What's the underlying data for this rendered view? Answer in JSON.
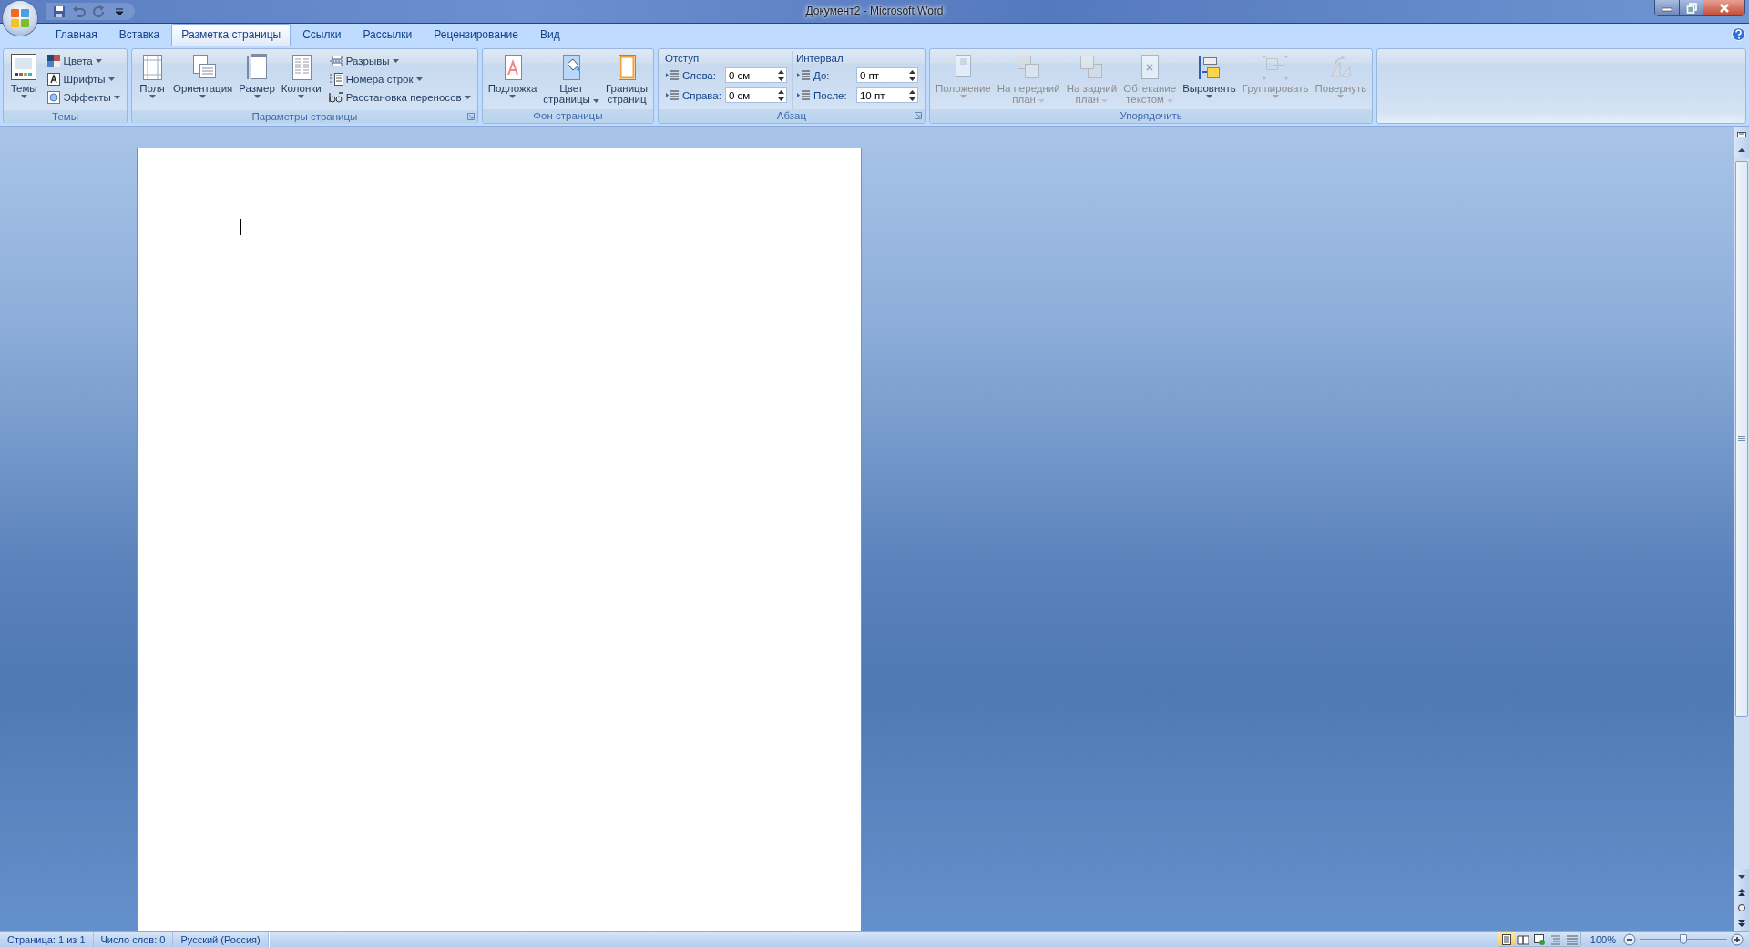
{
  "title_bar": {
    "title": "Документ2 - Microsoft Word"
  },
  "quick_access": [
    {
      "disabled": false
    },
    {
      "disabled": true
    },
    {
      "disabled": true
    },
    {
      "disabled": false
    }
  ],
  "tabs": [
    {
      "label": "Главная",
      "selected": false
    },
    {
      "label": "Вставка",
      "selected": false
    },
    {
      "label": "Разметка страницы",
      "selected": true
    },
    {
      "label": "Ссылки",
      "selected": false
    },
    {
      "label": "Рассылки",
      "selected": false
    },
    {
      "label": "Рецензирование",
      "selected": false
    },
    {
      "label": "Вид",
      "selected": false
    }
  ],
  "ribbon": {
    "groups": [
      {
        "label": "Темы",
        "launcher": false,
        "items": [
          {
            "kind": "big",
            "label": "Темы",
            "dropdown": true,
            "disabled": false
          },
          {
            "kind": "small",
            "label": "Цвета",
            "dropdown": true,
            "disabled": false
          },
          {
            "kind": "small",
            "label": "Шрифты",
            "dropdown": true,
            "disabled": false
          },
          {
            "kind": "small",
            "label": "Эффекты",
            "dropdown": true,
            "disabled": false
          }
        ]
      },
      {
        "label": "Параметры страницы",
        "launcher": true,
        "items": [
          {
            "kind": "big",
            "label": "Поля",
            "dropdown": true,
            "disabled": false
          },
          {
            "kind": "big",
            "label": "Ориентация",
            "dropdown": true,
            "disabled": false
          },
          {
            "kind": "big",
            "label": "Размер",
            "dropdown": true,
            "disabled": false
          },
          {
            "kind": "big",
            "label": "Колонки",
            "dropdown": true,
            "disabled": false
          },
          {
            "kind": "small",
            "label": "Разрывы",
            "dropdown": true,
            "disabled": false
          },
          {
            "kind": "small",
            "label": "Номера строк",
            "dropdown": true,
            "disabled": false
          },
          {
            "kind": "small",
            "label": "Расстановка переносов",
            "dropdown": true,
            "disabled": false
          }
        ]
      },
      {
        "label": "Фон страницы",
        "launcher": false,
        "items": [
          {
            "kind": "big",
            "label": "Подложка",
            "dropdown": true,
            "disabled": false
          },
          {
            "kind": "big",
            "label": "Цвет\nстраницы",
            "dropdown": true,
            "disabled": false
          },
          {
            "kind": "big",
            "label": "Границы\nстраниц",
            "dropdown": false,
            "disabled": false
          }
        ]
      },
      {
        "label": "Абзац",
        "launcher": true,
        "sections": [
          {
            "label": "Отступ",
            "fields": [
              {
                "label": "Слева:",
                "value": "0 см"
              },
              {
                "label": "Справа:",
                "value": "0 см"
              }
            ]
          },
          {
            "label": "Интервал",
            "fields": [
              {
                "label": "До:",
                "value": "0 пт"
              },
              {
                "label": "После:",
                "value": "10 пт"
              }
            ]
          }
        ]
      },
      {
        "label": "Упорядочить",
        "launcher": false,
        "items": [
          {
            "kind": "big",
            "label": "Положение",
            "dropdown": true,
            "disabled": true
          },
          {
            "kind": "big",
            "label": "На передний\nплан",
            "dropdown": true,
            "disabled": true
          },
          {
            "kind": "big",
            "label": "На задний\nплан",
            "dropdown": true,
            "disabled": true
          },
          {
            "kind": "big",
            "label": "Обтекание\nтекстом",
            "dropdown": true,
            "disabled": true
          },
          {
            "kind": "big",
            "label": "Выровнять",
            "dropdown": true,
            "disabled": false
          },
          {
            "kind": "big",
            "label": "Группировать",
            "dropdown": true,
            "disabled": true
          },
          {
            "kind": "big",
            "label": "Повернуть",
            "dropdown": true,
            "disabled": true
          }
        ]
      }
    ]
  },
  "status_bar": {
    "items": [
      "Страница: 1 из 1",
      "Число слов: 0",
      "Русский (Россия)"
    ],
    "views": [
      {
        "selected": true
      },
      {
        "selected": false
      },
      {
        "selected": false
      },
      {
        "selected": false
      },
      {
        "selected": false
      }
    ],
    "zoom": "100%",
    "zoom_slider": {
      "level": 0.5
    }
  }
}
